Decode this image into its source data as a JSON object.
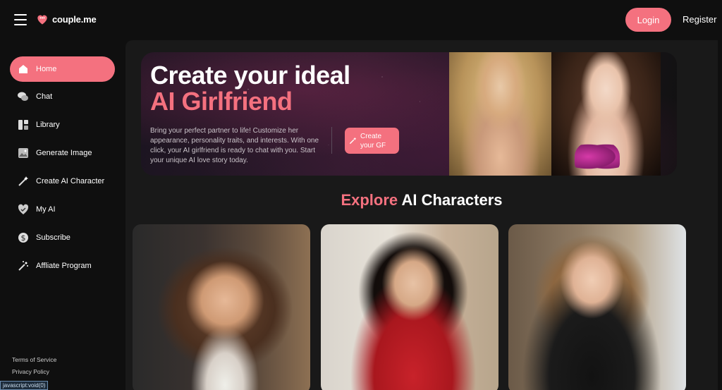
{
  "header": {
    "logo_text": "couple.me",
    "login_label": "Login",
    "register_label": "Register"
  },
  "sidebar": {
    "items": [
      {
        "label": "Home",
        "icon": "home-icon",
        "active": true
      },
      {
        "label": "Chat",
        "icon": "chat-icon"
      },
      {
        "label": "Library",
        "icon": "library-icon"
      },
      {
        "label": "Generate Image",
        "icon": "image-icon"
      },
      {
        "label": "Create AI Character",
        "icon": "magic-wand-icon"
      },
      {
        "label": "My AI",
        "icon": "heart-shield-icon"
      },
      {
        "label": "Subscribe",
        "icon": "dollar-icon"
      },
      {
        "label": "Affliate Program",
        "icon": "sparkle-wand-icon"
      }
    ],
    "footer": {
      "terms": "Terms of Service",
      "privacy": "Privacy Policy"
    }
  },
  "status_bar": {
    "text": "javascript:void(0)"
  },
  "hero": {
    "title_line1": "Create your ideal",
    "title_line2": "AI Girlfriend",
    "description": "Bring your perfect partner to life! Customize her appearance, personality traits, and interests. With one click, your AI girlfriend is ready to chat with you. Start your unique AI love story today.",
    "cta_label": "Create your GF"
  },
  "explore": {
    "title_accent": "Explore",
    "title_rest": " AI Characters"
  },
  "colors": {
    "accent": "#f4717f",
    "background": "#0f0f0f",
    "panel": "#191919"
  }
}
